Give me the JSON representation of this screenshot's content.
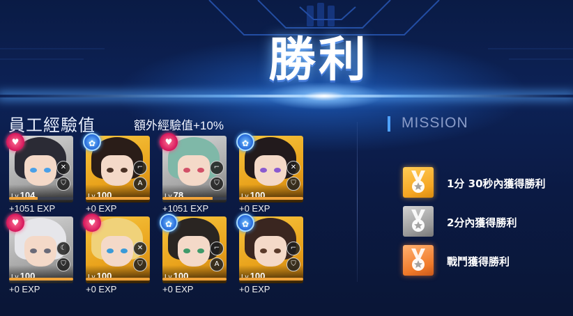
{
  "result": {
    "title": "勝利"
  },
  "exp_section": {
    "title": "員工經驗值",
    "bonus": "額外經驗值+10%"
  },
  "characters": [
    {
      "badge": "pink",
      "badge_icon": "heart-icon",
      "frame": "gray",
      "level_prefix": "Lv.",
      "level": "104",
      "exp_fill": 0.45,
      "exp_text": "+1051 EXP",
      "hair": "#2b2b35",
      "eye": "#4aa0e8",
      "weapons": [
        "crossed-swords-icon",
        "shield-icon"
      ]
    },
    {
      "badge": "blue",
      "badge_icon": "ribbon-icon",
      "frame": "gold",
      "level_prefix": "Lv.",
      "level": "100",
      "exp_fill": 1.0,
      "exp_text": "+0 EXP",
      "hair": "#2a1d18",
      "eye": "#4a3226",
      "weapons": [
        "gun-icon",
        "all-icon"
      ]
    },
    {
      "badge": "pink",
      "badge_icon": "heart-icon",
      "frame": "gray",
      "level_prefix": "Lv.",
      "level": "78",
      "exp_fill": 0.78,
      "exp_text": "+1051 EXP",
      "hair": "#7fb8a8",
      "eye": "#d25068",
      "weapons": [
        "gun-icon",
        "shield-icon"
      ]
    },
    {
      "badge": "blue",
      "badge_icon": "ribbon-icon",
      "frame": "gold",
      "level_prefix": "Lv.",
      "level": "100",
      "exp_fill": 1.0,
      "exp_text": "+0 EXP",
      "hair": "#221a1c",
      "eye": "#8a5ad0",
      "weapons": [
        "crossed-swords-icon",
        "shield-icon"
      ]
    },
    {
      "badge": "pink",
      "badge_icon": "heart-icon",
      "frame": "gray",
      "level_prefix": "Lv.",
      "level": "100",
      "exp_fill": 1.0,
      "exp_text": "+0 EXP",
      "hair": "#e6e6ea",
      "eye": "#6a6a78",
      "weapons": [
        "moon-icon",
        "shield-icon"
      ]
    },
    {
      "badge": "pink",
      "badge_icon": "heart-icon",
      "frame": "gold",
      "level_prefix": "Lv.",
      "level": "100",
      "exp_fill": 1.0,
      "exp_text": "+0 EXP",
      "hair": "#f0d27a",
      "eye": "#3a9ad8",
      "weapons": [
        "crossed-swords-icon",
        "shield-icon"
      ]
    },
    {
      "badge": "blue",
      "badge_icon": "ribbon-icon",
      "frame": "gold",
      "level_prefix": "Lv.",
      "level": "100",
      "exp_fill": 1.0,
      "exp_text": "+0 EXP",
      "hair": "#2a2522",
      "eye": "#3f9a6a",
      "weapons": [
        "gun-icon",
        "all-icon"
      ]
    },
    {
      "badge": "blue",
      "badge_icon": "ribbon-icon",
      "frame": "gold",
      "level_prefix": "Lv.",
      "level": "100",
      "exp_fill": 1.0,
      "exp_text": "+0 EXP",
      "hair": "#3a2620",
      "eye": "#5a3a2a",
      "weapons": [
        "gun-icon",
        "shield-icon"
      ]
    }
  ],
  "mission": {
    "title": "MISSION",
    "items": [
      {
        "medal": "gold",
        "text": "1分 30秒內獲得勝利"
      },
      {
        "medal": "silver",
        "text": "2分內獲得勝利"
      },
      {
        "medal": "bronze",
        "text": "戰鬥獲得勝利"
      }
    ]
  }
}
